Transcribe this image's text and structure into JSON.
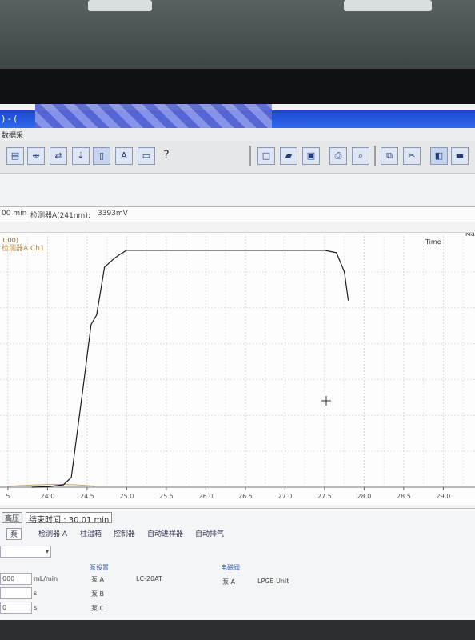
{
  "window": {
    "title_left": ") - (",
    "menu": [
      "数据采"
    ]
  },
  "toolbar": {
    "help_label": "?"
  },
  "info_line": {
    "left": "00 min",
    "detector": "检测器A(241nm):",
    "value": "3393mV"
  },
  "chart_data": {
    "type": "line",
    "title": "",
    "legend_prefix": "1.00)",
    "series": [
      {
        "name": "检测器A Ch1",
        "points": [
          [
            23.8,
            0
          ],
          [
            24.0,
            0.2
          ],
          [
            24.2,
            1
          ],
          [
            24.3,
            4
          ],
          [
            24.45,
            42
          ],
          [
            24.55,
            68
          ],
          [
            24.62,
            72
          ],
          [
            24.72,
            92
          ],
          [
            24.82,
            95
          ],
          [
            24.9,
            97
          ],
          [
            25.0,
            99
          ],
          [
            26.0,
            99
          ],
          [
            27.0,
            99
          ],
          [
            27.3,
            99
          ],
          [
            27.5,
            99
          ],
          [
            27.65,
            98
          ],
          [
            27.75,
            90
          ],
          [
            27.8,
            78
          ]
        ]
      }
    ],
    "xlim": [
      23.4,
      29.4
    ],
    "ylim": [
      0,
      105
    ],
    "x_ticks": [
      23.5,
      24.0,
      24.5,
      25.0,
      25.5,
      26.0,
      26.5,
      27.0,
      27.5,
      28.0,
      28.5,
      29.0
    ],
    "x_tick_labels": [
      "5",
      "24.0",
      "24.5",
      "25.0",
      "25.5",
      "26.0",
      "26.5",
      "27.0",
      "27.5",
      "28.0",
      "28.5",
      "29.0"
    ],
    "y_axis_label_right": "Time",
    "top_right_label": "Ma",
    "grid": true,
    "line_color": "#1a1a1a",
    "baseline_color": "#c9a96b"
  },
  "bottom_panel": {
    "stop_button": "高压",
    "end_time_label": "结束时间",
    "end_time_value": ": 30.01 min",
    "tabs": [
      "泵",
      "检测器 A",
      "柱温箱",
      "控制器",
      "自动进样器",
      "自动排气"
    ],
    "flow_value": "000",
    "flow_unit": "mL/min",
    "unit_s1": "s",
    "unit_s2": "s",
    "field_c_value": "0",
    "pumps_header": "泵设置",
    "pump_a": "泵 A",
    "pump_a_model": "LC-20AT",
    "pump_b": "泵 B",
    "pump_c": "泵 C",
    "valve_header": "电磁阀",
    "valve_a": "泵 A",
    "valve_a_unit": "LPGE Unit"
  }
}
